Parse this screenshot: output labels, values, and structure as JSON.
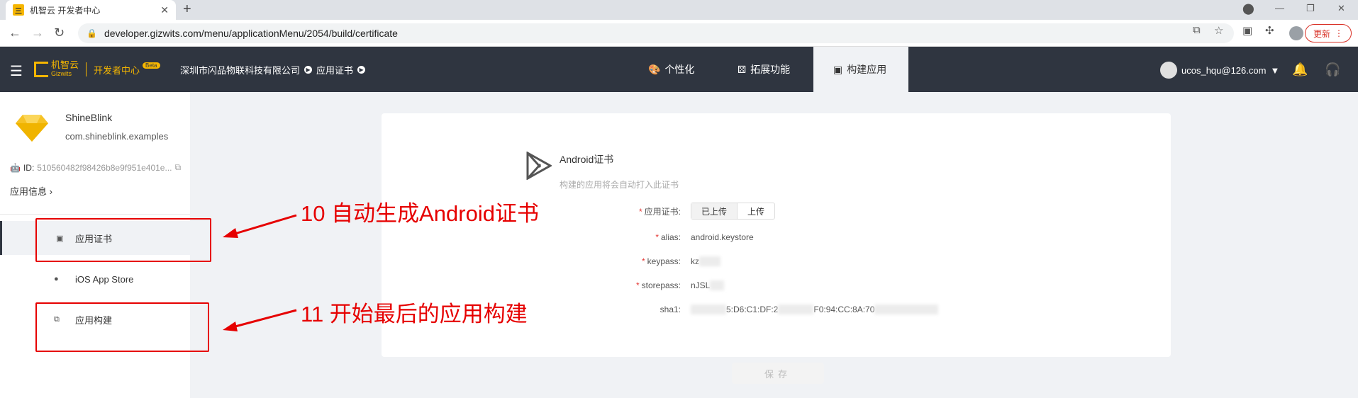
{
  "browser": {
    "tab_title": "机智云 开发者中心",
    "url": "developer.gizwits.com/menu/applicationMenu/2054/build/certificate",
    "update_label": "更新"
  },
  "header": {
    "logo_text": "机智云",
    "logo_sub": "Gizwits",
    "portal": "开发者中心",
    "beta": "Beta",
    "breadcrumb_company": "深圳市闪品物联科技有限公司",
    "breadcrumb_page": "应用证书",
    "nav": [
      {
        "label": "个性化",
        "icon": "palette-icon"
      },
      {
        "label": "拓展功能",
        "icon": "dice-icon"
      },
      {
        "label": "构建应用",
        "icon": "package-icon"
      }
    ],
    "user_email": "ucos_hqu@126.com"
  },
  "sidebar": {
    "app_name": "ShineBlink",
    "app_package": "com.shineblink.examples",
    "id_label": "ID:",
    "id_value": "510560482f98426b8e9f951e401e...",
    "app_info_label": "应用信息",
    "items": [
      {
        "label": "应用证书",
        "icon": "certificate-icon",
        "active": true
      },
      {
        "label": "iOS App Store",
        "icon": "apple-icon",
        "active": false
      },
      {
        "label": "应用构建",
        "icon": "copy-icon",
        "active": false
      }
    ]
  },
  "certificate": {
    "title": "Android证书",
    "subtitle": "构建的应用将会自动打入此证书",
    "fields": {
      "cert_label": "应用证书:",
      "uploaded_option": "已上传",
      "upload_option": "上传",
      "alias_label": "alias:",
      "alias_value": "android.keystore",
      "keypass_label": "keypass:",
      "keypass_value": "kz",
      "storepass_label": "storepass:",
      "storepass_value": "nJSL",
      "sha1_label": "sha1:",
      "sha1_part1": "5:D6:C1:DF:2",
      "sha1_part2": "F0:94:CC:8A:70"
    },
    "save_label": "保存"
  },
  "annotations": {
    "step10": "10 自动生成Android证书",
    "step11": "11 开始最后的应用构建"
  },
  "colors": {
    "header_bg": "#2f3540",
    "accent": "#f6b600",
    "annotation": "#e60000"
  }
}
